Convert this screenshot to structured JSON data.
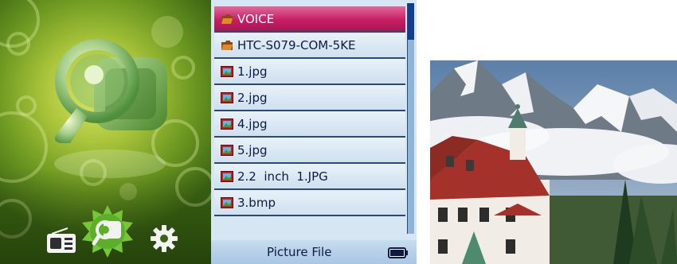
{
  "main_menu": {
    "highlighted_item": "picture",
    "dock_items": [
      {
        "name": "radio",
        "icon": "radio-icon"
      },
      {
        "name": "picture",
        "icon": "picture-icon"
      },
      {
        "name": "settings",
        "icon": "gear-icon"
      }
    ]
  },
  "file_browser": {
    "files": [
      {
        "label": "VOICE",
        "type": "folder",
        "selected": true
      },
      {
        "label": "HTC-S079-COM-5KE",
        "type": "folder",
        "selected": false
      },
      {
        "label": "1.jpg",
        "type": "image",
        "selected": false
      },
      {
        "label": "2.jpg",
        "type": "image",
        "selected": false
      },
      {
        "label": "4.jpg",
        "type": "image",
        "selected": false
      },
      {
        "label": "5.jpg",
        "type": "image",
        "selected": false
      },
      {
        "label": "2.2  inch  1.JPG",
        "type": "image",
        "selected": false
      },
      {
        "label": "3.bmp",
        "type": "image",
        "selected": false
      }
    ],
    "status": {
      "title": "Picture  File",
      "battery_icon": "battery-icon",
      "battery_level": 1.0
    }
  },
  "preview": {
    "content": "photo-preview",
    "subject": "castle with mountains"
  },
  "colors": {
    "selection": "#c81e64",
    "list_text": "#0d1a44",
    "row_divider": "#2b4a72",
    "menu_green": "#a9c43a"
  }
}
